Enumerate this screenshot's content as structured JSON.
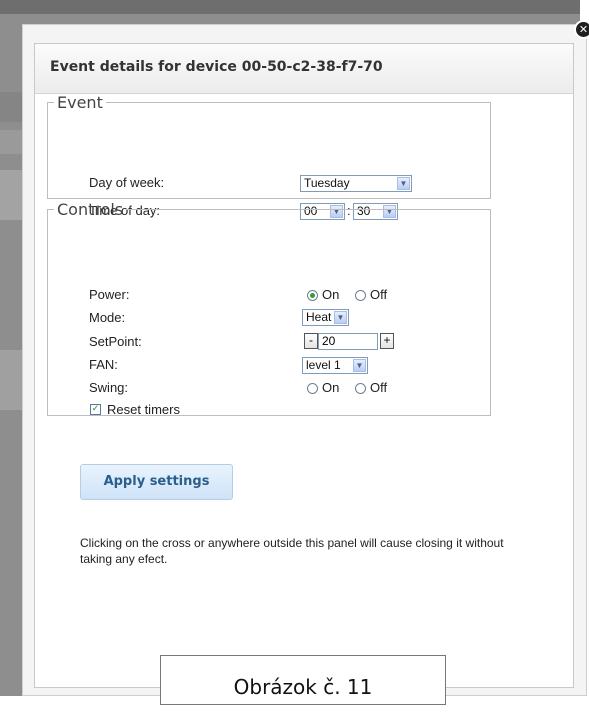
{
  "dialog": {
    "title": "Event details for device 00-50-c2-38-f7-70",
    "close_icon": "close-icon"
  },
  "event": {
    "legend": "Event",
    "day_label": "Day of week:",
    "day_value": "Tuesday",
    "time_label": "Time of day:",
    "hour_value": "00",
    "separator": ":",
    "minute_value": "30"
  },
  "controls": {
    "legend": "Controls",
    "power_label": "Power:",
    "power_on": "On",
    "power_off": "Off",
    "mode_label": "Mode:",
    "mode_value": "Heat",
    "setpoint_label": "SetPoint:",
    "minus": "-",
    "setpoint_value": "20",
    "plus": "+",
    "fan_label": "FAN:",
    "fan_value": "level 1",
    "swing_label": "Swing:",
    "swing_on": "On",
    "swing_off": "Off",
    "reset_label": "Reset timers"
  },
  "apply_label": "Apply settings",
  "note": "Clicking on the cross or anywhere outside this panel will cause closing it without taking any efect.",
  "caption": "Obrázok č. 11"
}
